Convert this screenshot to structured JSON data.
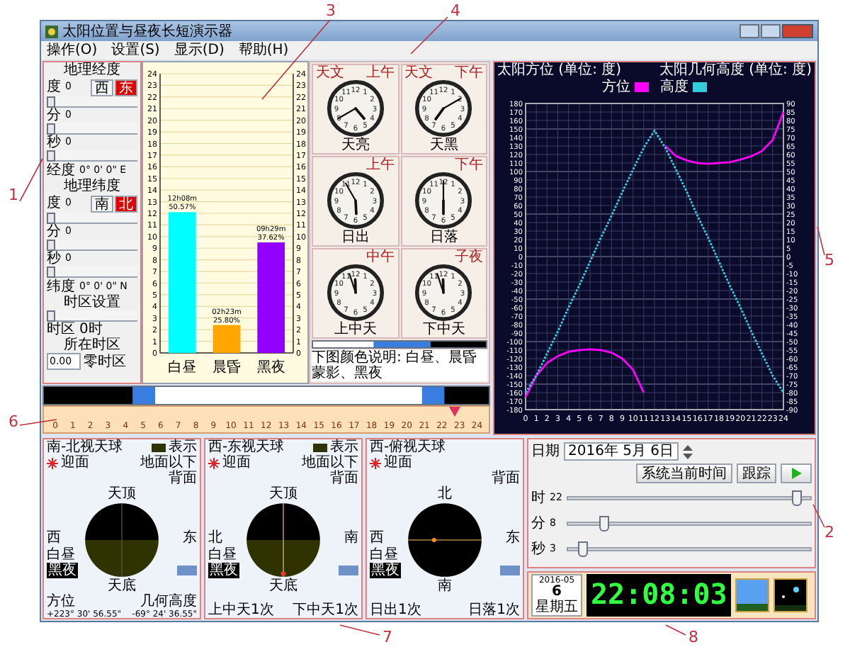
{
  "window": {
    "title": "太阳位置与昼夜长短演示器"
  },
  "menu": [
    {
      "label": "操作(O)"
    },
    {
      "label": "设置(S)"
    },
    {
      "label": "显示(D)"
    },
    {
      "label": "帮助(H)"
    }
  ],
  "left_panel": {
    "sections": [
      {
        "title": "地理经度",
        "dir_buttons": [
          {
            "label": "西",
            "selected": false
          },
          {
            "label": "东",
            "selected": true
          }
        ],
        "rows": [
          {
            "label": "度",
            "value": "0",
            "level": 0
          },
          {
            "label": "分",
            "value": "0",
            "level": 0
          },
          {
            "label": "秒",
            "value": "0",
            "level": 0
          }
        ],
        "result_label": "经度",
        "result": "0° 0' 0\" E"
      },
      {
        "title": "地理纬度",
        "dir_buttons": [
          {
            "label": "南",
            "selected": false
          },
          {
            "label": "北",
            "selected": true
          }
        ],
        "rows": [
          {
            "label": "度",
            "value": "0",
            "level": 0
          },
          {
            "label": "分",
            "value": "0",
            "level": 0
          },
          {
            "label": "秒",
            "value": "0",
            "level": 0
          }
        ],
        "result_label": "纬度",
        "result": "0° 0' 0\" N"
      }
    ],
    "timezone": {
      "title": "时区设置",
      "level": 0,
      "label": "时区",
      "value": "0时",
      "caption": "所在时区",
      "field": "0.00",
      "zone": "零时区"
    }
  },
  "bar_chart": {
    "chart_data": {
      "type": "bar",
      "categories": [
        "白昼",
        "晨昏",
        "黑夜"
      ],
      "series": [
        {
          "color": "#00ffff",
          "values": [
            12.1,
            null,
            null
          ]
        },
        {
          "color": "#ffa500",
          "values": [
            null,
            2.4,
            null
          ]
        },
        {
          "color": "#9400ff",
          "values": [
            null,
            null,
            9.5
          ]
        }
      ],
      "ylim": [
        0,
        24
      ],
      "y2lim": [
        0,
        24
      ],
      "grid": true,
      "yticks": [
        0,
        1,
        2,
        3,
        4,
        5,
        6,
        7,
        8,
        9,
        10,
        11,
        12,
        13,
        14,
        15,
        16,
        17,
        18,
        19,
        20,
        21,
        22,
        23,
        24
      ],
      "y2ticks": [
        0,
        1,
        2,
        3,
        4,
        5,
        6,
        7,
        8,
        9,
        10,
        11,
        12,
        13,
        14,
        15,
        16,
        17,
        18,
        19,
        20,
        21,
        22,
        23,
        24
      ],
      "value_labels": [
        "12h08m 50.57%",
        "02h23m 25.80%",
        "09h29m 37.62%"
      ]
    }
  },
  "clocks": [
    {
      "corner_left": "天文",
      "corner_right": "上午",
      "label": "天亮",
      "numerals": [
        "11",
        "12",
        "1",
        "10",
        "2",
        "9",
        "3",
        "8",
        "4",
        "7",
        "6",
        "5"
      ]
    },
    {
      "corner_left": "天文",
      "corner_right": "下午",
      "label": "天黑",
      "numerals": [
        "11",
        "12",
        "1",
        "10",
        "2",
        "9",
        "3",
        "8",
        "4",
        "7",
        "6",
        "5"
      ]
    },
    {
      "corner_right": "上午",
      "label": "日出",
      "numerals": [
        "11",
        "12",
        "1",
        "10",
        "2",
        "9",
        "3",
        "8",
        "4",
        "7",
        "6",
        "5"
      ]
    },
    {
      "corner_right": "下午",
      "label": "日落",
      "numerals": [
        "11",
        "12",
        "1",
        "10",
        "2",
        "9",
        "3",
        "8",
        "4",
        "7",
        "6",
        "5"
      ]
    },
    {
      "corner_right": "中午",
      "label": "上中天",
      "numerals": [
        "11",
        "12",
        "1",
        "10",
        "2",
        "9",
        "3",
        "8",
        "4",
        "7",
        "6",
        "5"
      ]
    },
    {
      "corner_right": "子夜",
      "label": "下中天",
      "numerals": [
        "11",
        "12",
        "1",
        "10",
        "2",
        "9",
        "3",
        "8",
        "4",
        "7",
        "6",
        "5"
      ]
    }
  ],
  "clock_legend": {
    "text": "下图颜色说明: 白昼、晨昏蒙影、黑夜"
  },
  "hour_ruler": {
    "ticks": [
      "0",
      "1",
      "2",
      "3",
      "4",
      "5",
      "6",
      "7",
      "8",
      "9",
      "10",
      "11",
      "12",
      "13",
      "14",
      "15",
      "16",
      "17",
      "18",
      "19",
      "20",
      "21",
      "22",
      "23",
      "24"
    ],
    "level": 0.922
  },
  "sun_chart": {
    "chart_data": {
      "type": "line",
      "ylabel": "太阳方位 (单位: 度)",
      "y2label": "太阳几何高度 (单位: 度)",
      "x": [
        0,
        1,
        2,
        3,
        4,
        5,
        6,
        7,
        8,
        9,
        10,
        11,
        12,
        13,
        14,
        15,
        16,
        17,
        18,
        19,
        20,
        21,
        22,
        23,
        24
      ],
      "series": [
        {
          "name": "方位",
          "color": "#ff00ff",
          "values": [
            -165,
            -140,
            -125,
            -117,
            -112,
            -110,
            -109,
            -110,
            -113,
            -120,
            -133,
            -160,
            null,
            130,
            118,
            113,
            110,
            109,
            110,
            111,
            114,
            118,
            124,
            137,
            170
          ]
        },
        {
          "name": "高度",
          "color": "#33ccdd",
          "axis": "y2",
          "line_style": "dashed",
          "values": [
            -80,
            -70,
            -57,
            -44,
            -30,
            -17,
            -3,
            11,
            24,
            38,
            51,
            64,
            74,
            64,
            51,
            38,
            24,
            11,
            -3,
            -17,
            -30,
            -44,
            -57,
            -70,
            -80
          ]
        }
      ],
      "xlim": [
        0,
        24
      ],
      "ylim": [
        -180,
        180
      ],
      "y2lim": [
        -90,
        90
      ],
      "grid": true,
      "legend": "top",
      "xticks": [
        0,
        1,
        2,
        3,
        4,
        5,
        6,
        7,
        8,
        9,
        10,
        11,
        12,
        13,
        14,
        15,
        16,
        17,
        18,
        19,
        20,
        21,
        22,
        23,
        24
      ],
      "yticks": [
        -180,
        -170,
        -160,
        -150,
        -140,
        -130,
        -120,
        -110,
        -100,
        -90,
        -80,
        -70,
        -60,
        -50,
        -40,
        -30,
        -20,
        -10,
        0,
        10,
        20,
        30,
        40,
        50,
        60,
        70,
        80,
        90,
        100,
        110,
        120,
        130,
        140,
        150,
        160,
        170,
        180
      ],
      "y2ticks": [
        -90,
        -85,
        -80,
        -75,
        -70,
        -65,
        -60,
        -55,
        -50,
        -45,
        -40,
        -35,
        -30,
        -25,
        -20,
        -15,
        -10,
        -5,
        0,
        5,
        10,
        15,
        20,
        25,
        30,
        35,
        40,
        45,
        50,
        55,
        60,
        65,
        70,
        75,
        80,
        85,
        90
      ]
    }
  },
  "sky_panels": [
    {
      "kind": "side",
      "title": "南-北视天球",
      "legend": [
        "表示",
        "地面以下"
      ],
      "front": "迎面",
      "back": "背面",
      "top_label": "天顶",
      "bottom_label": "天底",
      "left_label": "西",
      "right_label": "东",
      "day_label": "白昼",
      "tag": "黑夜",
      "footer": [
        {
          "label": "方位",
          "value": "+223° 30' 56.55\""
        },
        {
          "label": "几何高度",
          "value": "-69° 24' 36.55\""
        }
      ]
    },
    {
      "kind": "meridian",
      "title": "西-东视天球",
      "legend": [
        "表示",
        "地面以下"
      ],
      "front": "迎面",
      "back": "背面",
      "top_label": "天顶",
      "bottom_label": "天底",
      "left_label": "北",
      "right_label": "南",
      "day_label": "白昼",
      "tag": "黑夜",
      "footer": [
        {
          "label": "上中天1次"
        },
        {
          "label": "下中天1次"
        }
      ]
    },
    {
      "kind": "top",
      "title": "西-俯视天球",
      "front": "迎面",
      "back": "背面",
      "top_label": "北",
      "bottom_label": "南",
      "left_label": "西",
      "right_label": "东",
      "day_label": "白昼",
      "tag": "黑夜",
      "footer": [
        {
          "label": "日出1次"
        },
        {
          "label": "日落1次"
        }
      ]
    }
  ],
  "controls": {
    "date_label": "日期",
    "date": "2016年 5月 6日",
    "buttons": [
      {
        "kind": "text",
        "label": "系统当前时间"
      },
      {
        "kind": "text",
        "label": "跟踪"
      },
      {
        "kind": "play"
      }
    ],
    "sliders": [
      {
        "label": "时",
        "value": "22",
        "level": 0.957
      },
      {
        "label": "分",
        "value": "8",
        "level": 0.136
      },
      {
        "label": "秒",
        "value": "3",
        "level": 0.05
      }
    ]
  },
  "digital_clock": {
    "year_month": "2016-05",
    "day": "6",
    "weekday": "星期五",
    "time": "22:08:03"
  },
  "annotations": [
    {
      "label": "1"
    },
    {
      "label": "2"
    },
    {
      "label": "3"
    },
    {
      "label": "4"
    },
    {
      "label": "5"
    },
    {
      "label": "6"
    },
    {
      "label": "7"
    },
    {
      "label": "8"
    }
  ]
}
